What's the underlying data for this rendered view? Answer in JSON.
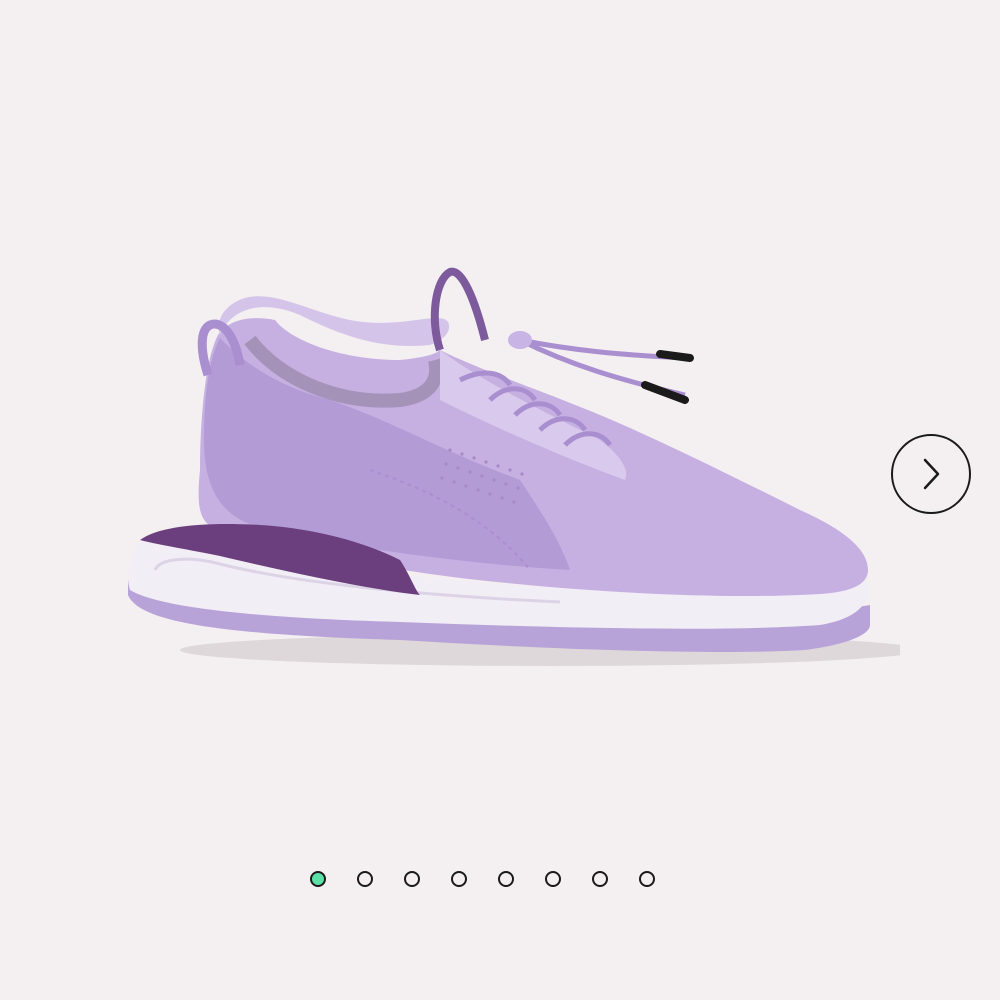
{
  "gallery": {
    "background_color": "#f4eff0",
    "active_index": 0,
    "slide_count": 8,
    "active_dot_color": "#5de0a6",
    "next_icon": "chevron-right-icon",
    "product_colors": {
      "upper": "#c6b0e2",
      "upper_dark": "#a98fcf",
      "heel_accent": "#6b3f7d",
      "midsole": "#f2eef5",
      "outsole": "#b8a3d9",
      "lace_tips": "#1a1a1a"
    }
  }
}
